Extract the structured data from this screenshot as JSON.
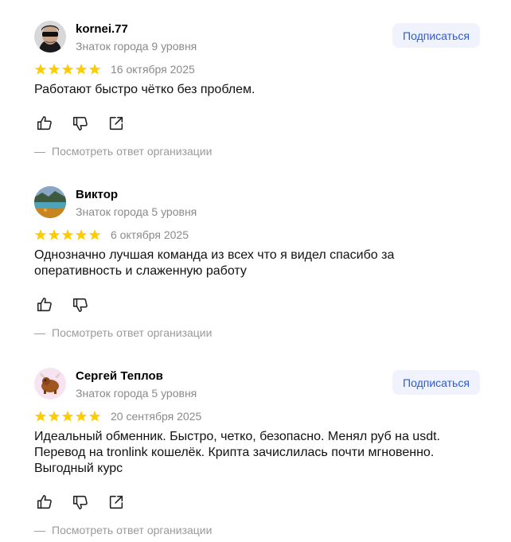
{
  "reviews": [
    {
      "author": "kornei.77",
      "level": "Знаток города 9 уровня",
      "subscribe_label": "Подписаться",
      "rating": 5,
      "date": "16 октября 2025",
      "text": "Работают быстро чётко без проблем.",
      "org_reply_label": "Посмотреть ответ организации",
      "avatar_icon": "sunglasses-avatar"
    },
    {
      "author": "Виктор",
      "level": "Знаток города 5 уровня",
      "rating": 5,
      "date": "6 октября 2025",
      "text": "Однозначно лучшая команда из всех что я видел спасибо за оперативность и слаженную работу",
      "org_reply_label": "Посмотреть ответ организации",
      "avatar_icon": "landscape-avatar"
    },
    {
      "author": "Сергей Теплов",
      "level": "Знаток города 5 уровня",
      "subscribe_label": "Подписаться",
      "rating": 5,
      "date": "20 сентября 2025",
      "text": "Идеальный обменник. Быстро, четко, безопасно. Менял руб на usdt. Перевод на tronlink кошелёк. Крипта зачислилась почти мгновенно. Выгодный курс",
      "org_reply_label": "Посмотреть ответ организации",
      "avatar_icon": "yak-avatar"
    }
  ],
  "reply_dash": "—",
  "colors": {
    "star": "#fc0",
    "subscribe_bg": "#f0f3fd",
    "subscribe_text": "#2b5ad8",
    "muted_text": "#8a8a8a"
  },
  "icons": [
    "thumb-up-icon",
    "thumb-down-icon",
    "share-icon",
    "star-icon"
  ]
}
